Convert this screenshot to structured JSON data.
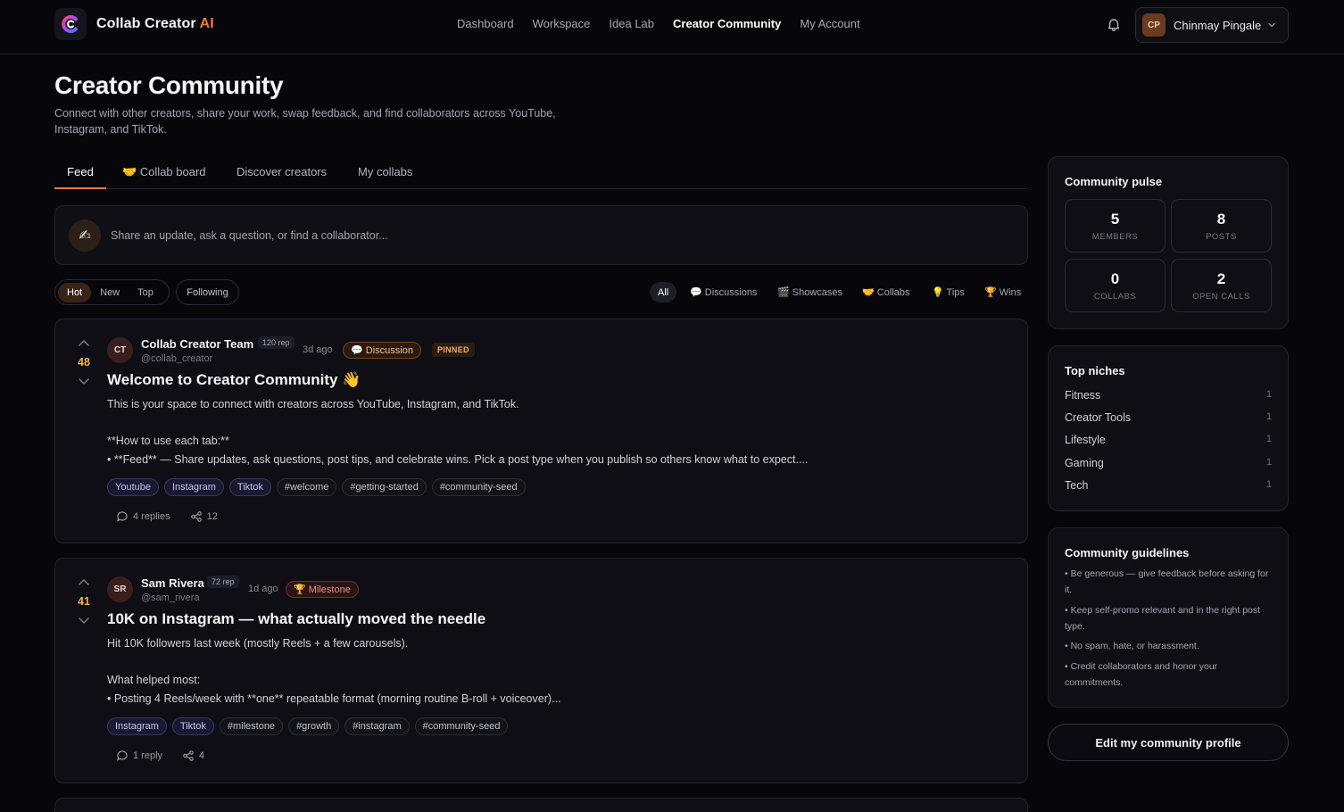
{
  "app": {
    "brand": "Collab Creator",
    "brand_ai": "AI"
  },
  "nav": {
    "links": [
      "Dashboard",
      "Workspace",
      "Idea Lab",
      "Creator Community",
      "My Account"
    ],
    "active": "Creator Community"
  },
  "account": {
    "initials": "CP",
    "name": "Chinmay Pingale"
  },
  "header": {
    "title": "Creator Community",
    "subtitle": "Connect with other creators, share your work, swap feedback, and find collaborators across YouTube, Instagram, and TikTok."
  },
  "tabs": [
    "Feed",
    "🤝 Collab board",
    "Discover creators",
    "My collabs"
  ],
  "composer": {
    "avatar": "✍",
    "placeholder": "Share an update, ask a question, or find a collaborator..."
  },
  "sort": [
    "Hot",
    "New",
    "Top"
  ],
  "following": "Following",
  "type_filters": [
    "All",
    "💬 Discussions",
    "🎬 Showcases",
    "🤝 Collabs",
    "💡 Tips",
    "🏆 Wins"
  ],
  "posts": [
    {
      "votes": "48",
      "initials": "CT",
      "author": "Collab Creator Team",
      "rep": "120 rep",
      "handle": "@collab_creator",
      "ago": "3d ago",
      "type": "💬 Discussion",
      "pinned": "PINNED",
      "title": "Welcome to Creator Community 👋",
      "body": "This is your space to connect with creators across YouTube, Instagram, and TikTok.\n\n**How to use each tab:**\n• **Feed** — Share updates, ask questions, post tips, and celebrate wins. Pick a post type when you publish so others know what to expect....",
      "tags_platform": [
        "Youtube",
        "Instagram",
        "Tiktok"
      ],
      "tags_hash": [
        "#welcome",
        "#getting-started",
        "#community-seed"
      ],
      "replies": "4 replies",
      "shares": "12"
    },
    {
      "votes": "41",
      "initials": "SR",
      "author": "Sam Rivera",
      "rep": "72 rep",
      "handle": "@sam_rivera",
      "ago": "1d ago",
      "type": "🏆 Milestone",
      "title": "10K on Instagram — what actually moved the needle",
      "body": "Hit 10K followers last week (mostly Reels + a few carousels).\n\nWhat helped most:\n• Posting 4 Reels/week with **one** repeatable format (morning routine B-roll + voiceover)...",
      "tags_platform": [
        "Instagram",
        "Tiktok"
      ],
      "tags_hash": [
        "#milestone",
        "#growth",
        "#instagram",
        "#community-seed"
      ],
      "replies": "1 reply",
      "shares": "4"
    }
  ],
  "pulse": {
    "title": "Community pulse",
    "stats": [
      {
        "value": "5",
        "label": "MEMBERS"
      },
      {
        "value": "8",
        "label": "POSTS"
      },
      {
        "value": "0",
        "label": "COLLABS"
      },
      {
        "value": "2",
        "label": "OPEN CALLS"
      }
    ]
  },
  "niches": {
    "title": "Top niches",
    "items": [
      {
        "name": "Fitness",
        "count": "1"
      },
      {
        "name": "Creator Tools",
        "count": "1"
      },
      {
        "name": "Lifestyle",
        "count": "1"
      },
      {
        "name": "Gaming",
        "count": "1"
      },
      {
        "name": "Tech",
        "count": "1"
      }
    ]
  },
  "guidelines": {
    "title": "Community guidelines",
    "rules": [
      "• Be generous — give feedback before asking for it.",
      "• Keep self-promo relevant and in the right post type.",
      "• No spam, hate, or harassment.",
      "• Credit collaborators and honor your commitments."
    ]
  },
  "edit_profile": "Edit my community profile",
  "colors": {
    "accent": "#f27a3a",
    "vote": "#f2b54a",
    "background": "#07070b"
  }
}
